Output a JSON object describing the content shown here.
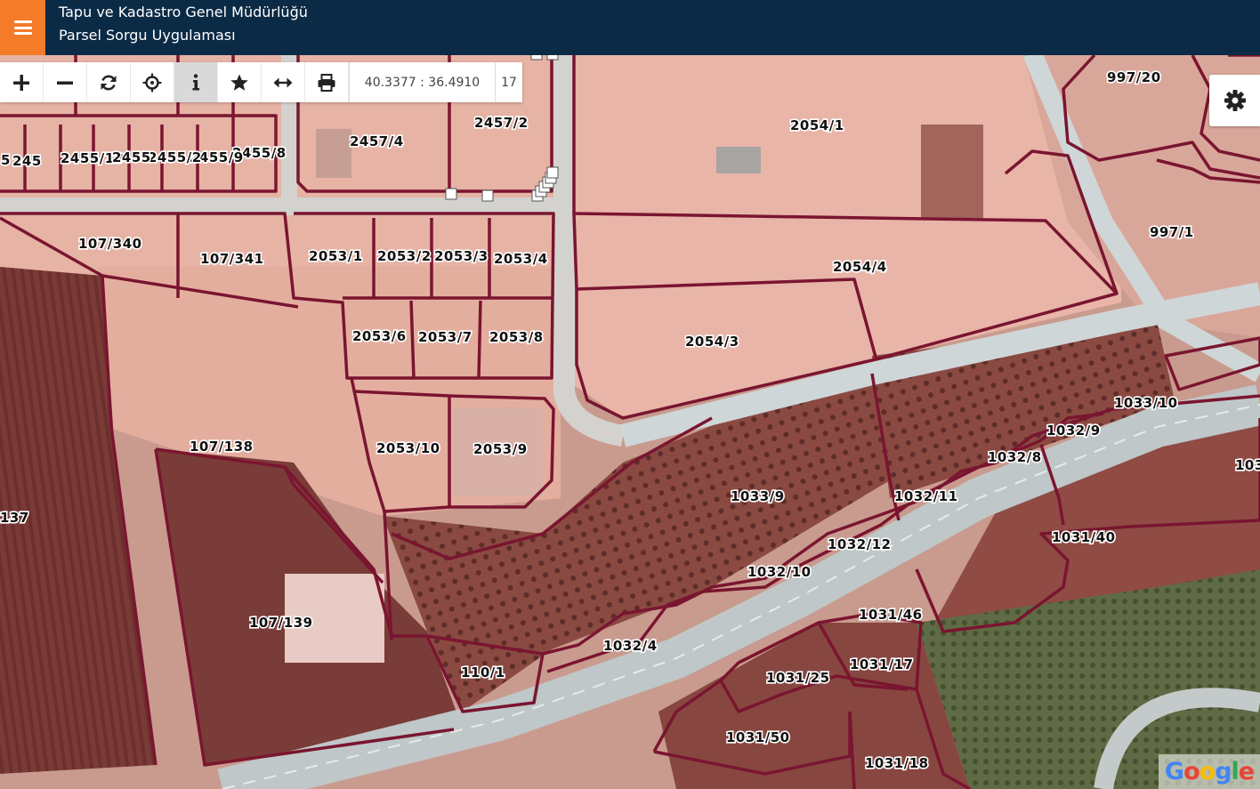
{
  "header": {
    "title_line1": "Tapu ve Kadastro Genel Müdürlüğü",
    "title_line2": "Parsel Sorgu Uygulaması"
  },
  "toolbar": {
    "buttons": [
      {
        "name": "zoom-in",
        "icon": "plus-icon",
        "active": false
      },
      {
        "name": "zoom-out",
        "icon": "minus-icon",
        "active": false
      },
      {
        "name": "refresh",
        "icon": "refresh-icon",
        "active": false
      },
      {
        "name": "locate",
        "icon": "crosshair-icon",
        "active": false
      },
      {
        "name": "info",
        "icon": "info-icon",
        "active": true
      },
      {
        "name": "favorites",
        "icon": "star-icon",
        "active": false
      },
      {
        "name": "measure",
        "icon": "arrows-horizontal-icon",
        "active": false
      },
      {
        "name": "print",
        "icon": "print-icon",
        "active": false
      }
    ],
    "coordinates": "40.3377 : 36.4910",
    "zoom_level": "17"
  },
  "settings": {
    "icon": "gear-icon"
  },
  "attribution": {
    "text": "Google"
  },
  "colors": {
    "header_bg": "#0b2a45",
    "menu_accent": "#f47b27",
    "parcel_border": "#7a1530",
    "road": "#cfd6d7",
    "bare_ground": "#e8b3a8",
    "cultivated_field": "#7d3d38"
  },
  "parcels": [
    {
      "label": "2457/4"
    },
    {
      "label": "2457/2"
    },
    {
      "label": "2054/1"
    },
    {
      "label": "997/20"
    },
    {
      "label": "997/1"
    },
    {
      "label": "2455/8"
    },
    {
      "label": "2455/9"
    },
    {
      "label": "2455/2"
    },
    {
      "label": "2455/13"
    },
    {
      "label": "2455"
    },
    {
      "label": "245"
    },
    {
      "label": "5"
    },
    {
      "label": "107/340"
    },
    {
      "label": "107/341"
    },
    {
      "label": "2053/1"
    },
    {
      "label": "2053/2"
    },
    {
      "label": "2053/3"
    },
    {
      "label": "2053/4"
    },
    {
      "label": "2054/4"
    },
    {
      "label": "2053/6"
    },
    {
      "label": "2053/7"
    },
    {
      "label": "2053/8"
    },
    {
      "label": "2054/3"
    },
    {
      "label": "2053/10"
    },
    {
      "label": "2053/9"
    },
    {
      "label": "107/138"
    },
    {
      "label": "137"
    },
    {
      "label": "1033/10"
    },
    {
      "label": "1032/9"
    },
    {
      "label": "1032/8"
    },
    {
      "label": "103"
    },
    {
      "label": "1033/9"
    },
    {
      "label": "1032/11"
    },
    {
      "label": "1031/40"
    },
    {
      "label": "1032/12"
    },
    {
      "label": "1032/10"
    },
    {
      "label": "1031/46"
    },
    {
      "label": "107/139"
    },
    {
      "label": "1032/4"
    },
    {
      "label": "110/1"
    },
    {
      "label": "1031/17"
    },
    {
      "label": "1031/25"
    },
    {
      "label": "1031/50"
    },
    {
      "label": "1031/18"
    }
  ]
}
